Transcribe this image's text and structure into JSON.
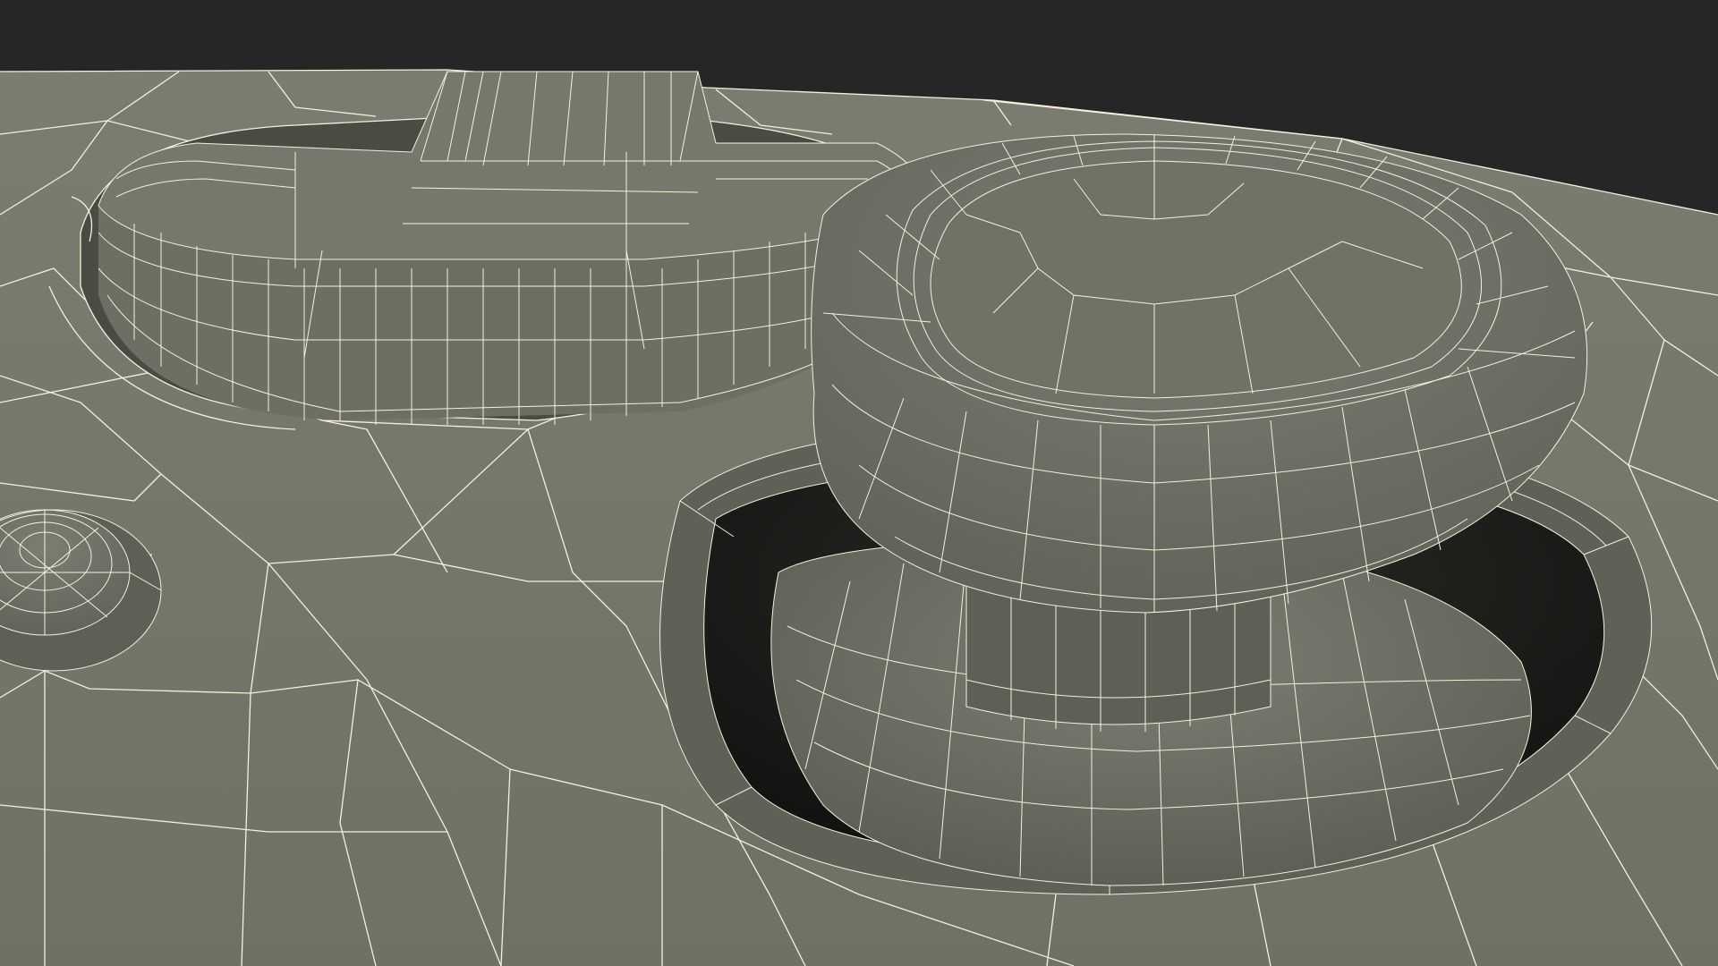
{
  "scene": {
    "subject": "wireframe-render",
    "colors": {
      "background": "#262626",
      "surface": "#74766a",
      "surface_light": "#7d7f73",
      "surface_dark": "#55574d",
      "cavity": "#1e1f1b",
      "wire": "#f4f1dc"
    }
  }
}
